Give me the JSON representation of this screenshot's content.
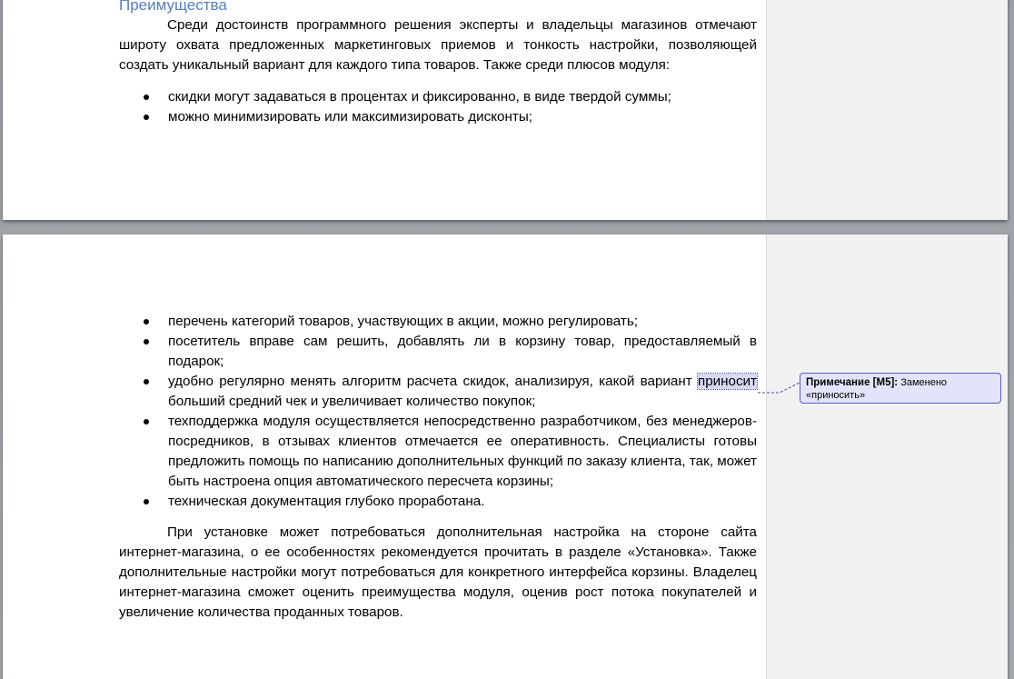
{
  "page1": {
    "heading": "Преимущества",
    "intro": "Среди достоинств программного решения эксперты и владельцы магазинов отмечают широту охвата предложенных маркетинговых приемов и тонкость настройки, позволяющей создать уникальный вариант для каждого типа товаров. Также среди плюсов модуля:",
    "bullets": [
      "скидки могут задаваться в процентах и фиксированно, в виде твердой суммы;",
      "можно минимизировать или максимизировать дисконты;"
    ]
  },
  "page2": {
    "bullet_1": "перечень категорий товаров, участвующих в акции, можно регулировать;",
    "bullet_2": "посетитель вправе сам решить, добавлять ли в корзину товар, предоставляемый в подарок;",
    "bullet_3_before": "удобно регулярно менять алгоритм расчета скидок, анализируя, какой вариант ",
    "bullet_3_highlight": "приносит",
    "bullet_3_after": " больший средний чек и увеличивает количество покупок;",
    "bullet_4": "техподдержка модуля осуществляется непосредственно разработчиком, без менеджеров-посредников, в отзывах клиентов отмечается ее оперативность. Специалисты готовы предложить помощь по написанию дополнительных функций по заказу клиента, так, может быть настроена опция автоматического пересчета корзины;",
    "bullet_5": "техническая документация глубоко проработана.",
    "closing": "При установке может потребоваться дополнительная настройка на стороне сайта интернет-магазина, о ее особенностях рекомендуется прочитать в разделе «Установка». Также дополнительные настройки могут потребоваться для конкретного интерфейса корзины. Владелец интернет-магазина сможет оценить преимущества модуля, оценив рост потока покупателей и увеличение количества проданных товаров."
  },
  "comment": {
    "label": "Примечание [M5]:",
    "text": "Заменено «приносить»",
    "border_color": "#5a5ad2",
    "fill_color": "#e3e3fb"
  },
  "colors": {
    "heading": "#4f81bd",
    "background": "#a0a3a8",
    "highlight": "#d8d8f4"
  }
}
